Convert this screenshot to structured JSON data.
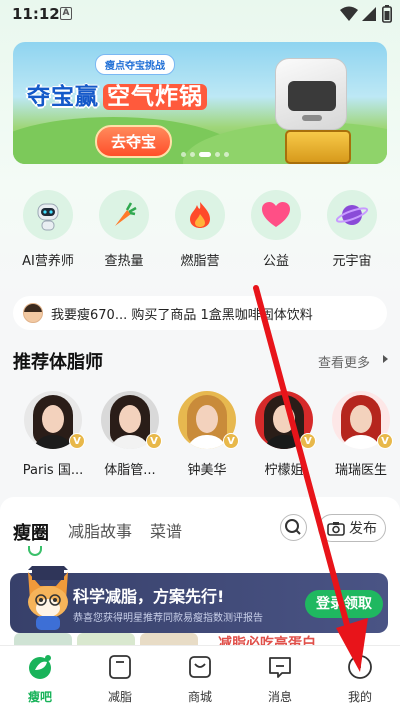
{
  "status_bar": {
    "time": "11:12",
    "a_icon": "A"
  },
  "banner": {
    "tag": "瘦点夺宝挑战",
    "title_prefix": "夺宝赢",
    "title_highlight": "空气炸锅",
    "button": "去夺宝"
  },
  "quick_links": [
    {
      "label": "AI营养师",
      "icon": "robot-icon"
    },
    {
      "label": "查热量",
      "icon": "carrot-icon"
    },
    {
      "label": "燃脂营",
      "icon": "flame-icon"
    },
    {
      "label": "公益",
      "icon": "heart-icon"
    },
    {
      "label": "元宇宙",
      "icon": "planet-icon"
    }
  ],
  "notice": {
    "text": "我要瘦670... 购买了商品 1盒黑咖啡固体饮料"
  },
  "coaches_section": {
    "title": "推荐体脂师",
    "more": "查看更多",
    "coaches": [
      {
        "name": "Paris 国...",
        "badge": "V"
      },
      {
        "name": "体脂管...",
        "badge": "V"
      },
      {
        "name": "钟美华",
        "badge": "V"
      },
      {
        "name": "柠檬姐",
        "badge": "V"
      },
      {
        "name": "瑞瑞医生",
        "badge": "V"
      }
    ]
  },
  "feed": {
    "tab_main": "瘦圈",
    "tab_story": "减脂故事",
    "tab_recipe": "菜谱",
    "post_label": "发布",
    "promo": {
      "title": "科学减脂，方案先行!",
      "subtitle": "恭喜您获得明星推荐同款易瘦指数测评报告",
      "button": "登录领取"
    },
    "peek_text": "减脂必吃高蛋白"
  },
  "bottom_nav": [
    {
      "label": "瘦吧",
      "icon": "leaf-icon",
      "active": true
    },
    {
      "label": "减脂",
      "icon": "scale-icon",
      "active": false
    },
    {
      "label": "商城",
      "icon": "bag-icon",
      "active": false
    },
    {
      "label": "消息",
      "icon": "message-icon",
      "active": false
    },
    {
      "label": "我的",
      "icon": "profile-icon",
      "active": false
    }
  ],
  "colors": {
    "accent": "#19b35a",
    "annotation": "#e8141a",
    "promo_bg": "#3f4877"
  }
}
